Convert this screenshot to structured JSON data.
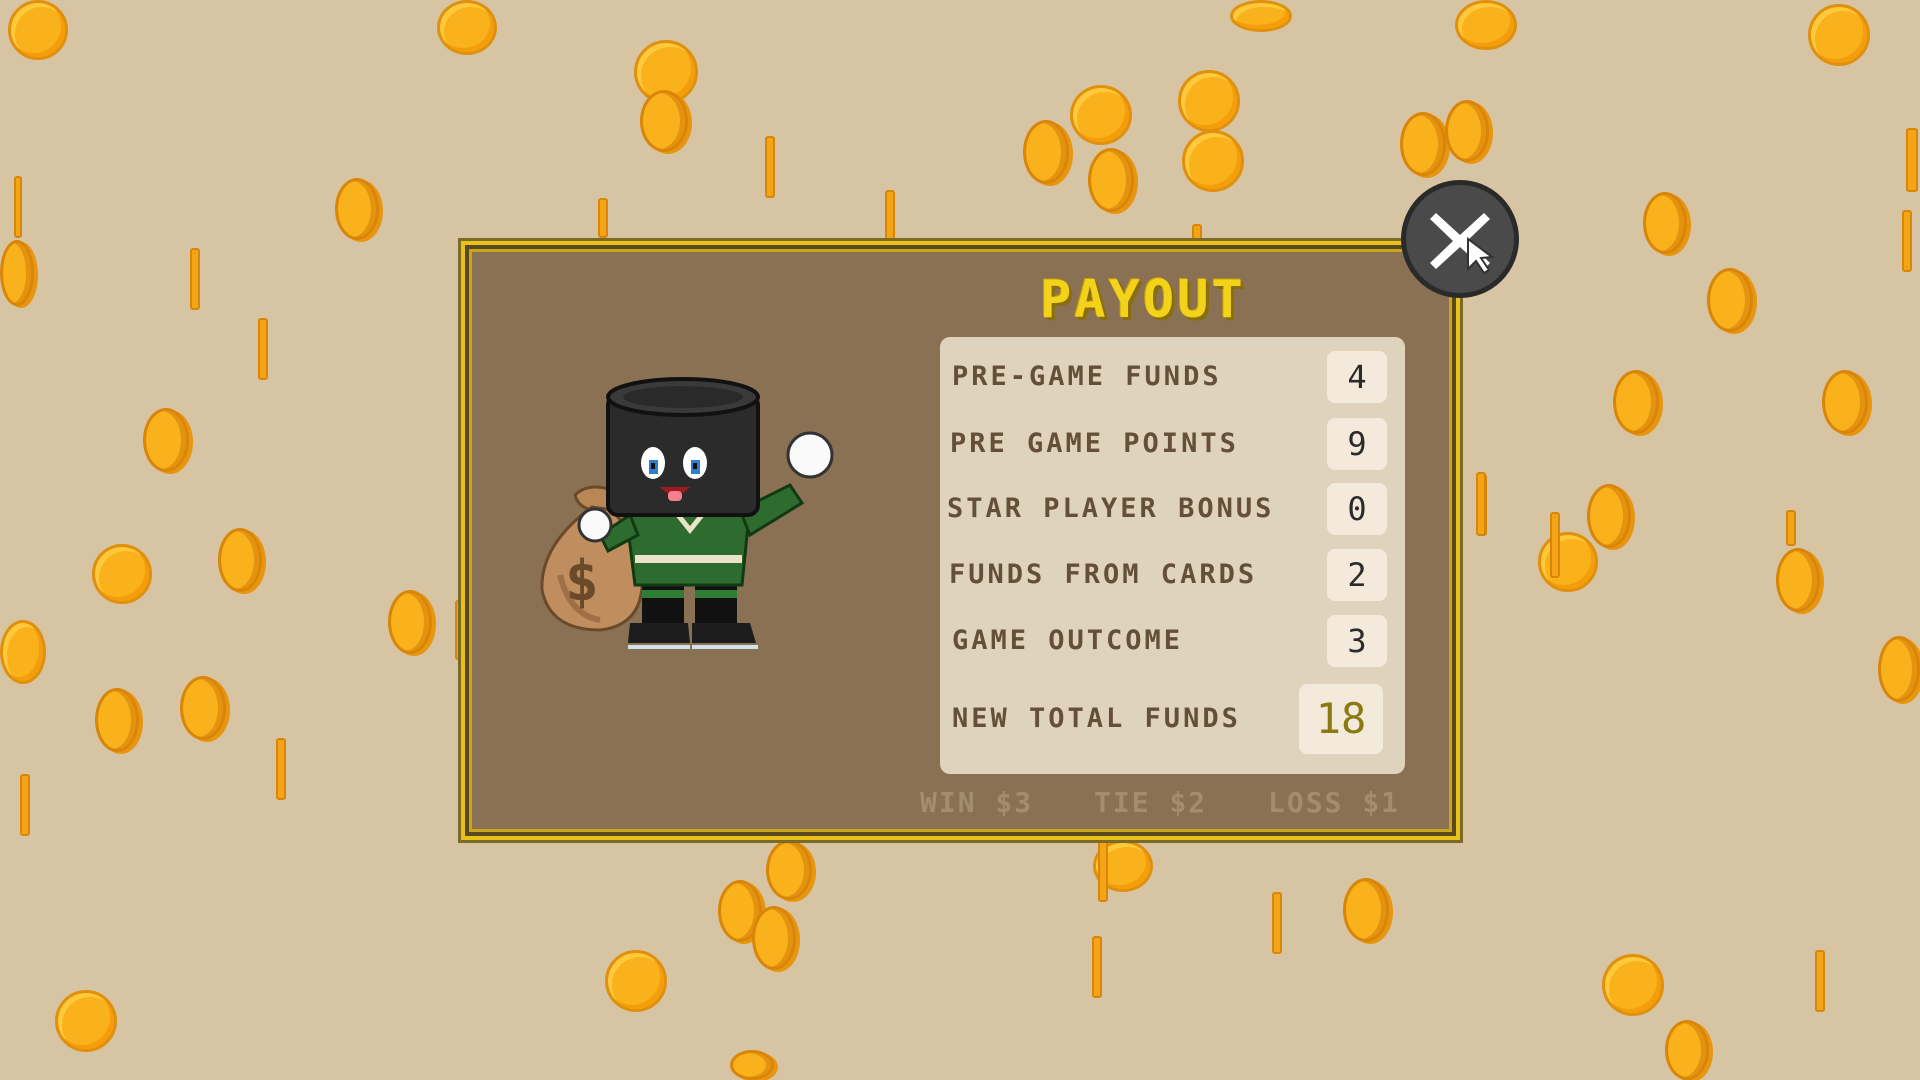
{
  "payout": {
    "title": "PAYOUT",
    "rows": [
      {
        "label": "PRE-GAME FUNDS",
        "value": "4"
      },
      {
        "label": "PRE GAME POINTS",
        "value": "9"
      },
      {
        "label": "STAR PLAYER BONUS",
        "value": "0"
      },
      {
        "label": "FUNDS FROM CARDS",
        "value": "2"
      },
      {
        "label": "GAME OUTCOME",
        "value": "3"
      }
    ],
    "total": {
      "label": "NEW TOTAL FUNDS",
      "value": "18"
    },
    "rates": {
      "win": "WIN $3",
      "tie": "TIE $2",
      "loss": "LOSS $1"
    }
  },
  "icons": {
    "close": "close-x-icon",
    "mascot": "hockey-puck-mascot-with-money-bag",
    "coin": "gold-coin-icon"
  },
  "colors": {
    "background": "#d6c4a3",
    "panel": "#8b7154",
    "panel_border": "#e8c11b",
    "title": "#f3d21b",
    "table_bg": "#e0d3bd",
    "coin": "#f9b11c",
    "jersey": "#2e6b2e"
  }
}
